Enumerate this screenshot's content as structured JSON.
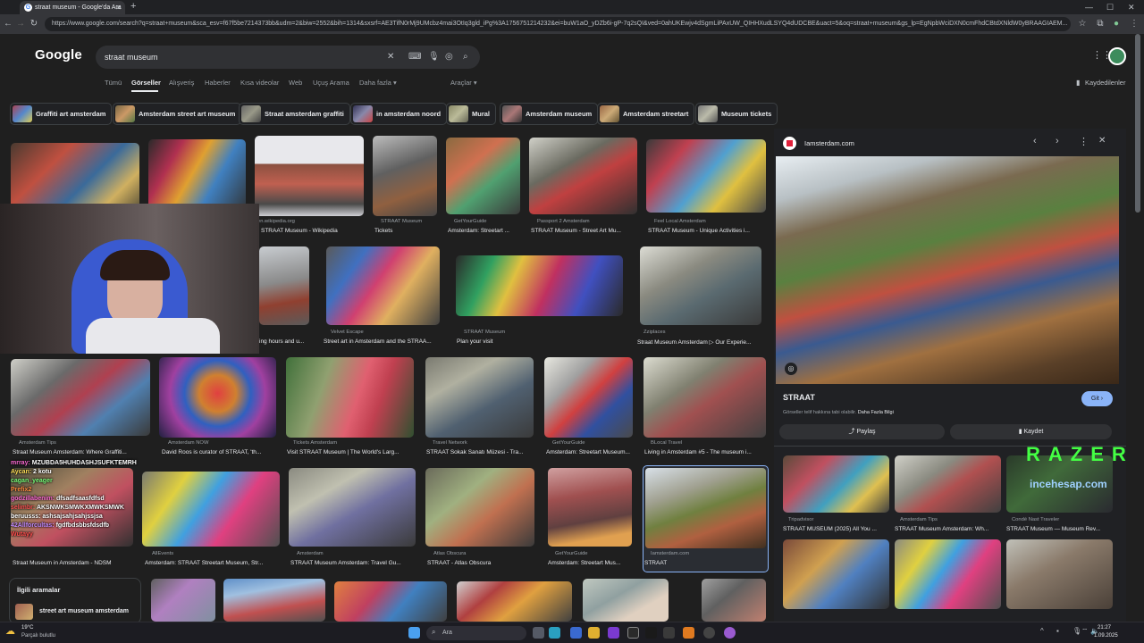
{
  "browser": {
    "tab_title": "straat museum - Google'da Ara",
    "url": "https://www.google.com/search?q=straat+museum&sca_esv=f67f5be7214373bb&udm=2&biw=2552&bih=1314&sxsrf=AE3TifN0rMj9UMcbz4mai3OtIq3gld_iPg%3A1756751214232&ei=buW1aO_yDZb6i-gP-7q2sQI&ved=0ahUKEwjv4dSgmLiPAxUW_QIHHXudLSYQ4dUDCBE&uact=5&oq=straat+museum&gs_lp=EgNpbWciDXN0cmFhdCBtdXNldW0yBRAAGIAEM..."
  },
  "google": {
    "logo": "Google",
    "query": "straat museum",
    "tabs": [
      "Tümü",
      "Görseller",
      "Alışveriş",
      "Haberler",
      "Kısa videolar",
      "Web",
      "Uçuş Arama",
      "Daha fazla ▾"
    ],
    "tools": "Araçlar ▾",
    "saved": "Kaydedilenler",
    "chips": [
      "Graffiti art amsterdam",
      "Amsterdam street art museum",
      "Straat amsterdam graffiti",
      "in amsterdam noord",
      "Mural",
      "Amsterdam museum",
      "Amsterdam streetart",
      "Museum tickets"
    ],
    "related_title": "İlgili aramalar",
    "related_item": "street art museum amsterdam"
  },
  "results": [
    {
      "src": "en.wikipedia.org",
      "title": "STRAAT Museum - Wikipedia"
    },
    {
      "src": "STRAAT Museum",
      "title": "Tickets"
    },
    {
      "src": "GetYourGuide",
      "title": "Amsterdam: Streetart ..."
    },
    {
      "src": "Passport 2 Amsterdam",
      "title": "STRAAT Museum - Street Art Mu..."
    },
    {
      "src": "Feel Local Amsterdam",
      "title": "STRAAT Museum - Unique Activities i..."
    },
    {
      "src": "",
      "title": "ing hours and u..."
    },
    {
      "src": "Velvet Escape",
      "title": "Street art in Amsterdam and the STRAA..."
    },
    {
      "src": "STRAAT Museum",
      "title": "Plan your visit"
    },
    {
      "src": "Zziplaces",
      "title": "Straat Museum Amsterdam ▷ Our Experie..."
    },
    {
      "src": "Amsterdam Tips",
      "title": "Straat Museum Amsterdam: Where Graffiti..."
    },
    {
      "src": "Amsterdam NOW",
      "title": "David Roos is curator of STRAAT, 'th..."
    },
    {
      "src": "Tickets Amsterdam",
      "title": "Visit STRAAT Museum | The World's Larg..."
    },
    {
      "src": "Travel Network",
      "title": "STRAAT Sokak Sanatı Müzesi - Tra..."
    },
    {
      "src": "GetYourGuide",
      "title": "Amsterdam: Streetart Museum..."
    },
    {
      "src": "BLocal Travel",
      "title": "Living in Amsterdam #5 - The museum i..."
    },
    {
      "src": "",
      "title": "Straat Museum in Amsterdam - NDSM"
    },
    {
      "src": "AllEvents",
      "title": "Amsterdam: STRAAT Streetart Museum, Str..."
    },
    {
      "src": "Amsterdam",
      "title": "STRAAT Museum Amsterdam: Travel Gu..."
    },
    {
      "src": "Atlas Obscura",
      "title": "STRAAT - Atlas Obscura"
    },
    {
      "src": "GetYourGuide",
      "title": "Amsterdam: Streetart Mus..."
    },
    {
      "src": "Iamsterdam.com",
      "title": "STRAAT"
    }
  ],
  "panel": {
    "site": "Iamsterdam.com",
    "title": "STRAAT",
    "visit": "Git ›",
    "copyright": "Görseller telif hakkına tabi olabilir.",
    "more_info": "Daha Fazla Bilgi",
    "share": "Paylaş",
    "save": "Kaydet",
    "related": [
      {
        "src": "Tripadvisor",
        "title": "STRAAT MUSEUM (2025) All You ..."
      },
      {
        "src": "Amsterdam Tips",
        "title": "STRAAT Museum Amsterdam: Wh..."
      },
      {
        "src": "Condé Nast Traveler",
        "title": "STRAAT Museum — Museum Rev..."
      }
    ]
  },
  "overlay": {
    "brand": "RAZER",
    "brand_url": "incehesap.com",
    "chat": [
      {
        "user": "mrray",
        "msg": "MZUBDA5HUHDASHJSUFKTEMRH",
        "color": "#ff6bd6"
      },
      {
        "user": "Aycan",
        "msg": "2 kotu",
        "color": "#ffde59"
      },
      {
        "user": "cagan_yeager",
        "msg": "",
        "color": "#7cff7c"
      },
      {
        "user": "Prefix2",
        "msg": "",
        "color": "#ff8c42"
      },
      {
        "user": "godzillabenim",
        "msg": "dfsadfsaasfdfsd",
        "color": "#ff6bd6"
      },
      {
        "user": "selimbr",
        "msg": "AKSNWKSMWKXMWKSMWK",
        "color": "#ff5555"
      },
      {
        "user": "beruusss",
        "msg": "ashsajsahjsahjssjsa",
        "color": "#ffffff"
      },
      {
        "user": "42Allforcultas",
        "msg": "fgdfbdsbbsfdsdfb",
        "color": "#c38bff"
      },
      {
        "user": "Wutayy",
        "msg": "",
        "color": "#ff4d4d"
      }
    ]
  },
  "taskbar": {
    "weather_temp": "19°C",
    "weather_desc": "Parçalı bulutlu",
    "search": "Ara",
    "time": "21:27",
    "date": "1.09.2025"
  },
  "colors": {
    "accent": "#8ab4f8",
    "bg": "#1f1f1f"
  }
}
